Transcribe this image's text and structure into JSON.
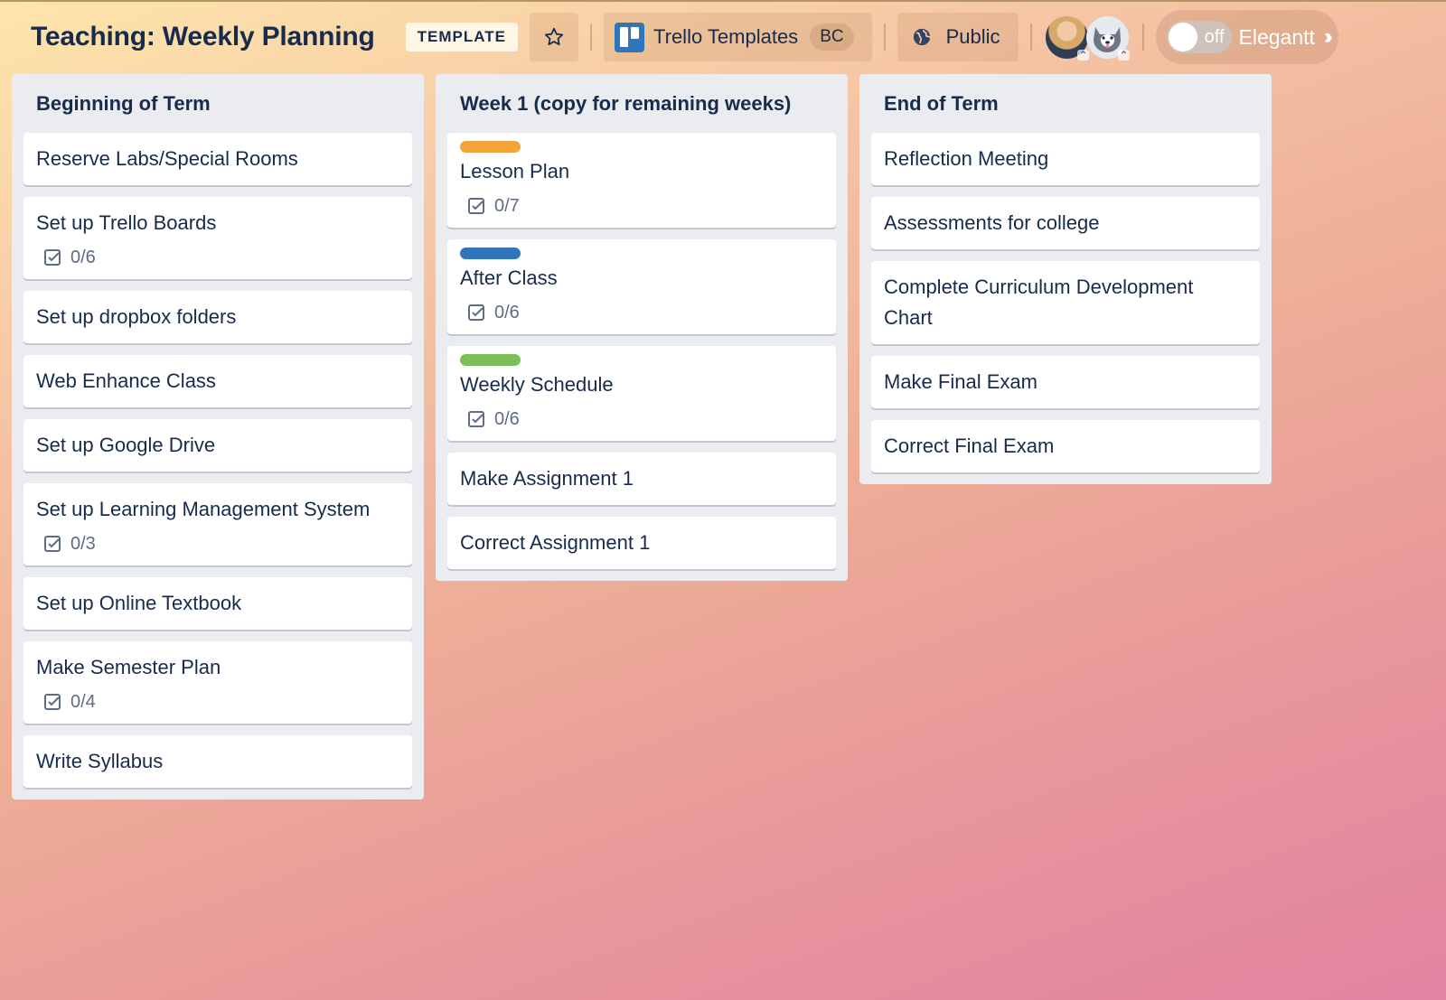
{
  "header": {
    "board_title": "Teaching: Weekly Planning",
    "template_badge": "TEMPLATE",
    "star_icon": "star-icon",
    "workspace": {
      "name": "Trello Templates",
      "badge": "BC",
      "icon": "trello-logo-icon"
    },
    "visibility": {
      "label": "Public",
      "icon": "globe-icon"
    },
    "members": [
      {
        "name": "member-avatar-woman",
        "admin_icon": "chevron-up-double-icon"
      },
      {
        "name": "member-avatar-husky",
        "admin_icon": "chevron-up-double-icon"
      }
    ],
    "elegantt": {
      "toggle_state": "off",
      "label": "Elegantt",
      "icon": "double-chevron-right-icon"
    }
  },
  "colors": {
    "label_orange": "#f2a43a",
    "label_blue": "#2f75bb",
    "label_green": "#7bbf5b",
    "list_bg": "#ebecf0",
    "text": "#172b4d"
  },
  "lists": [
    {
      "title": "Beginning of Term",
      "cards": [
        {
          "title": "Reserve Labs/Special Rooms"
        },
        {
          "title": "Set up Trello Boards",
          "checklist": "0/6"
        },
        {
          "title": "Set up dropbox folders"
        },
        {
          "title": "Web Enhance Class"
        },
        {
          "title": "Set up Google Drive"
        },
        {
          "title": "Set up Learning Management System",
          "checklist": "0/3"
        },
        {
          "title": "Set up Online Textbook"
        },
        {
          "title": "Make Semester Plan",
          "checklist": "0/4"
        },
        {
          "title": "Write Syllabus"
        }
      ]
    },
    {
      "title": "Week 1 (copy for remaining weeks)",
      "cards": [
        {
          "title": "Lesson Plan",
          "label": "orange",
          "checklist": "0/7"
        },
        {
          "title": "After Class",
          "label": "blue",
          "checklist": "0/6"
        },
        {
          "title": "Weekly Schedule",
          "label": "green",
          "checklist": "0/6"
        },
        {
          "title": "Make Assignment 1"
        },
        {
          "title": "Correct Assignment 1"
        }
      ]
    },
    {
      "title": "End of Term",
      "cards": [
        {
          "title": "Reflection Meeting"
        },
        {
          "title": "Assessments for college"
        },
        {
          "title": "Complete Curriculum Development Chart"
        },
        {
          "title": "Make Final Exam"
        },
        {
          "title": "Correct Final Exam"
        }
      ]
    }
  ]
}
